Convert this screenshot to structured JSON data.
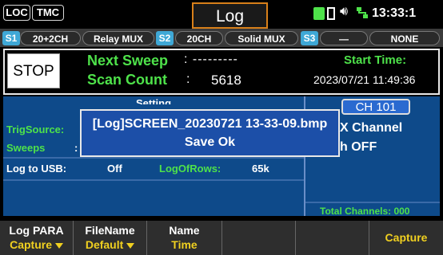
{
  "top": {
    "loc": "LOC",
    "tmc": "TMC",
    "title": "Log",
    "time": "13:33:1"
  },
  "slots": {
    "s1": "S1",
    "s1_card": "20+2CH",
    "s1_type": "Relay MUX",
    "s2": "S2",
    "s2_card": "20CH",
    "s2_type": "Solid MUX",
    "s3": "S3",
    "s3_card": "—",
    "s3_type": "NONE"
  },
  "control": {
    "stop_label": "STOP",
    "next_sweep_label": "Next Sweep",
    "next_sweep_value": ":  ---------",
    "scan_count_label": "Scan Count",
    "scan_count_sep": ":",
    "scan_count_value": "5618",
    "start_time_label": "Start Time:",
    "start_time_value": "2023/07/21 11:49:36"
  },
  "settings": {
    "header": "Setting",
    "trig_label": "TrigSource:",
    "sweeps_label": "Sweeps",
    "sweeps_colon": ":",
    "log_usb_label": "Log to USB:",
    "log_usb_value": "Off",
    "log_rows_label": "LogOfRows:",
    "log_rows_value": "65k",
    "channel_badge": "CH  101",
    "channel_line1": "X Channel",
    "channel_line2": "h OFF",
    "total_channels": "Total Channels: 000"
  },
  "dialog": {
    "line1": "[Log]SCREEN_20230721 13-33-09.bmp",
    "line2": "Save Ok"
  },
  "softkeys": [
    {
      "top": "Log PARA",
      "bottom": "Capture"
    },
    {
      "top": "FileName",
      "bottom": "Default"
    },
    {
      "top": "Name",
      "bottom": "Time"
    },
    {
      "top": "",
      "bottom": ""
    },
    {
      "top": "",
      "bottom": ""
    },
    {
      "top": "",
      "bottom": "Capture"
    }
  ]
}
